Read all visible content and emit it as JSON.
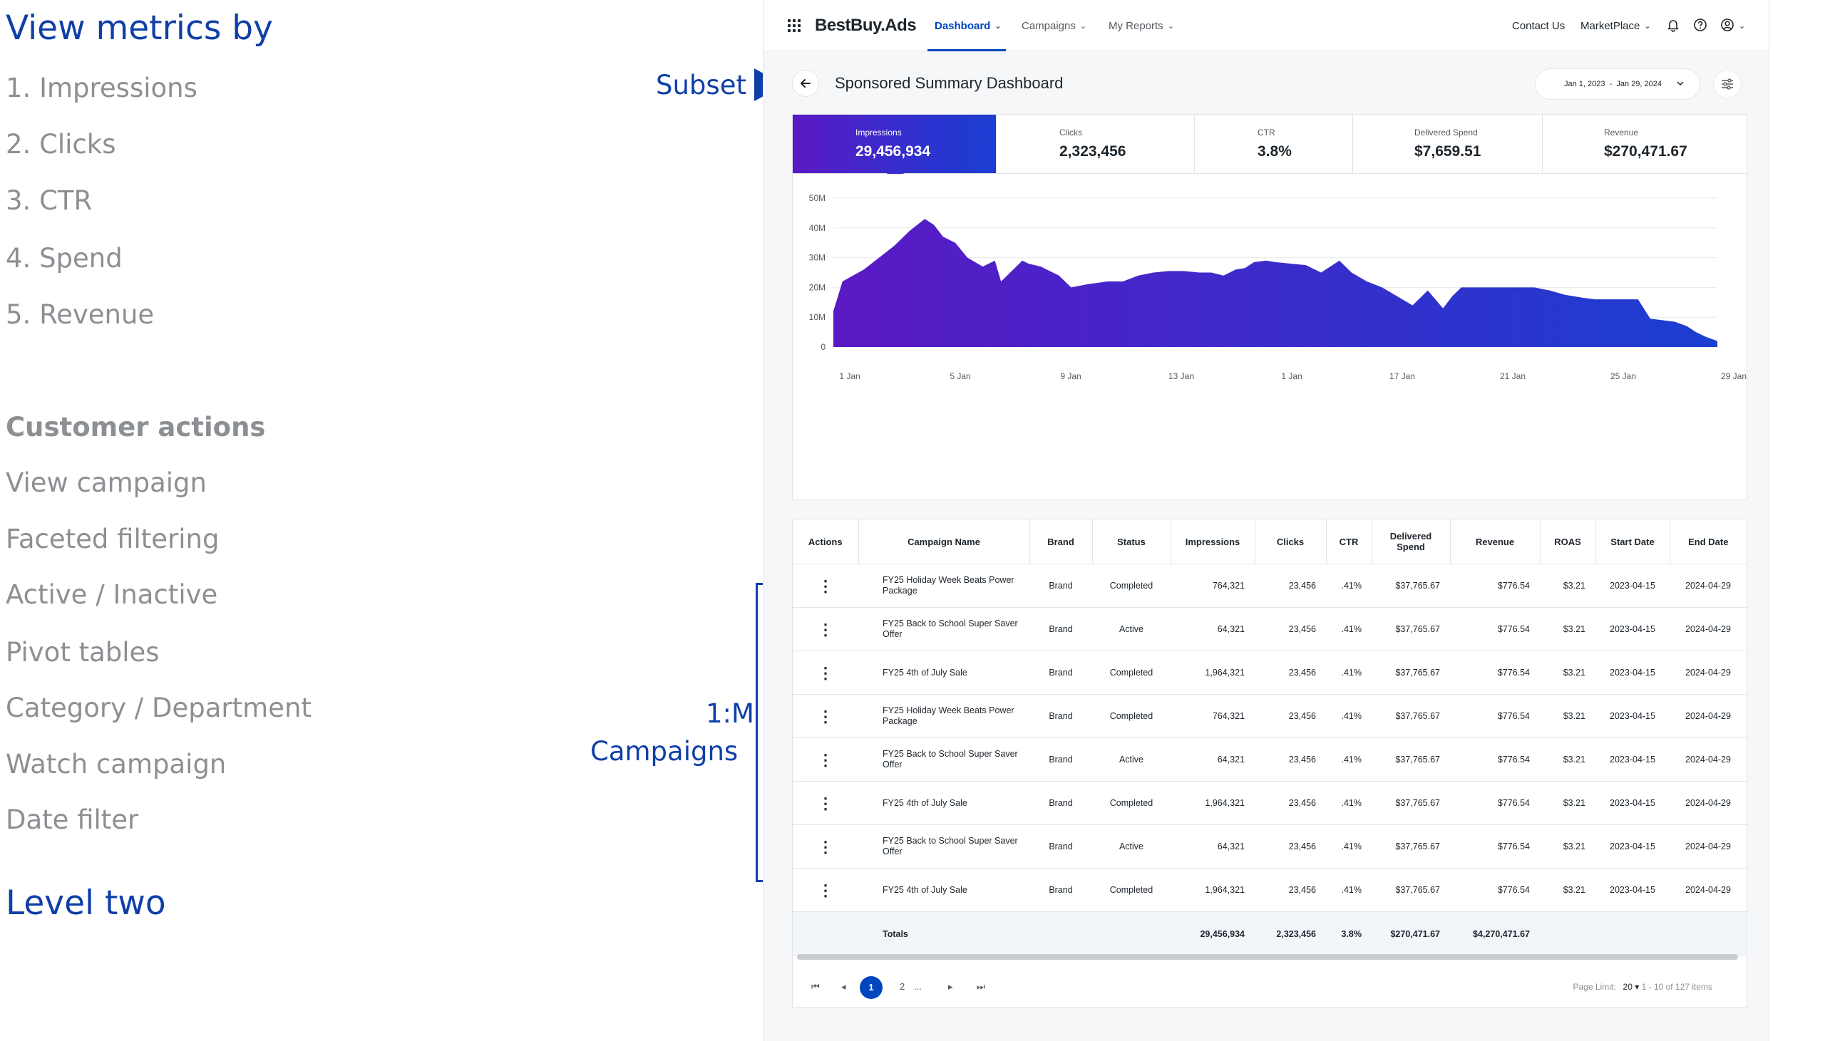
{
  "notes": {
    "view_heading": "View metrics by",
    "metrics_list": [
      "1. Impressions",
      "2. Clicks",
      "3. CTR",
      "4. Spend",
      "5. Revenue"
    ],
    "actions_heading": "Customer actions",
    "actions_list": [
      "View campaign",
      "Faceted filtering",
      "Active / Inactive",
      "Pivot tables",
      "Category / Department",
      "Watch campaign",
      "Date filter"
    ],
    "level": "Level two",
    "subset_label": "Subset",
    "one_to_many": "1:M",
    "campaigns_label": "Campaigns",
    "accent_color": "#0f3fa8"
  },
  "topbar": {
    "brand": "BestBuy.Ads",
    "nav": [
      "Dashboard",
      "Campaigns",
      "My Reports"
    ],
    "contact": "Contact Us",
    "marketplace": "MarketPlace",
    "icons": [
      "apps-grid-icon",
      "bell-icon",
      "help-icon",
      "account-icon"
    ]
  },
  "page": {
    "title": "Sponsored Summary Dashboard",
    "date_range": "Jan 1, 2023  -  Jan 29, 2024"
  },
  "metrics": [
    {
      "label": "Impressions",
      "value": "29,456,934"
    },
    {
      "label": "Clicks",
      "value": "2,323,456"
    },
    {
      "label": "CTR",
      "value": "3.8%"
    },
    {
      "label": "Delivered Spend",
      "value": "$7,659.51"
    },
    {
      "label": "Revenue",
      "value": "$270,471.67"
    }
  ],
  "chart_data": {
    "type": "area",
    "title": "",
    "xlabel": "",
    "ylabel": "",
    "ylim": [
      0,
      50
    ],
    "y_unit": "M",
    "yticks": [
      "0",
      "10M",
      "20M",
      "30M",
      "40M",
      "50M"
    ],
    "xticks": [
      "1 Jan",
      "5 Jan",
      "9 Jan",
      "13 Jan",
      "1 Jan",
      "17 Jan",
      "21 Jan",
      "25 Jan",
      "29 Jan"
    ],
    "x": [
      0,
      0.3,
      1,
      1.5,
      2,
      2.5,
      3,
      3.3,
      3.6,
      4,
      4.4,
      4.9,
      5.3,
      5.5,
      5.8,
      6,
      6.2,
      6.4,
      6.8,
      7.4,
      7.8,
      8.3,
      9,
      9.5,
      10,
      10.5,
      11,
      11.5,
      12,
      12.4,
      12.8,
      13.2,
      13.5,
      13.8,
      14.2,
      14.5,
      15,
      15.5,
      16,
      16.3,
      16.6,
      17,
      17.5,
      18,
      19,
      19.5,
      20,
      20.3,
      20.6,
      20.9,
      21.2,
      21.5,
      22,
      22.5,
      23,
      23.5,
      24,
      24.6,
      25,
      25.5,
      26,
      26.4,
      26.8,
      27.2,
      27.6,
      28,
      28.3,
      28.6,
      29
    ],
    "values": [
      12,
      22,
      26,
      30,
      34,
      39,
      43,
      41,
      37,
      35,
      30,
      27,
      29,
      22,
      25,
      27,
      29,
      28,
      27,
      24,
      20,
      21,
      22,
      22,
      24,
      25,
      25.5,
      25.5,
      25,
      25,
      24,
      26,
      26.5,
      28.5,
      29,
      28.5,
      28,
      27.5,
      25,
      27,
      29,
      25,
      22,
      20,
      14,
      19,
      13,
      17,
      20,
      20,
      20,
      20,
      20,
      20,
      20,
      19,
      17.5,
      16.5,
      16,
      16,
      16,
      16,
      9.5,
      9,
      8.5,
      7,
      5,
      3.5,
      2
    ],
    "gradient": [
      "#5b19c4",
      "#1b3ed1"
    ]
  },
  "table": {
    "headers": [
      "Actions",
      "Campaign Name",
      "Brand",
      "Status",
      "Impressions",
      "Clicks",
      "CTR",
      "Delivered Spend",
      "Revenue",
      "ROAS",
      "Start Date",
      "End Date"
    ],
    "rows": [
      [
        "⋮",
        "FY25 Holiday Week Beats Power Package",
        "Brand",
        "Completed",
        "764,321",
        "23,456",
        ".41%",
        "$37,765.67",
        "$776.54",
        "$3.21",
        "2023-04-15",
        "2024-04-29"
      ],
      [
        "⋮",
        "FY25 Back to School Super Saver Offer",
        "Brand",
        "Active",
        "64,321",
        "23,456",
        ".41%",
        "$37,765.67",
        "$776.54",
        "$3.21",
        "2023-04-15",
        "2024-04-29"
      ],
      [
        "⋮",
        "FY25 4th of July Sale",
        "Brand",
        "Completed",
        "1,964,321",
        "23,456",
        ".41%",
        "$37,765.67",
        "$776.54",
        "$3.21",
        "2023-04-15",
        "2024-04-29"
      ],
      [
        "⋮",
        "FY25 Holiday Week Beats Power Package",
        "Brand",
        "Completed",
        "764,321",
        "23,456",
        ".41%",
        "$37,765.67",
        "$776.54",
        "$3.21",
        "2023-04-15",
        "2024-04-29"
      ],
      [
        "⋮",
        "FY25 Back to School Super Saver Offer",
        "Brand",
        "Active",
        "64,321",
        "23,456",
        ".41%",
        "$37,765.67",
        "$776.54",
        "$3.21",
        "2023-04-15",
        "2024-04-29"
      ],
      [
        "⋮",
        "FY25 4th of July Sale",
        "Brand",
        "Completed",
        "1,964,321",
        "23,456",
        ".41%",
        "$37,765.67",
        "$776.54",
        "$3.21",
        "2023-04-15",
        "2024-04-29"
      ],
      [
        "⋮",
        "FY25 Back to School Super Saver Offer",
        "Brand",
        "Active",
        "64,321",
        "23,456",
        ".41%",
        "$37,765.67",
        "$776.54",
        "$3.21",
        "2023-04-15",
        "2024-04-29"
      ],
      [
        "⋮",
        "FY25 4th of July Sale",
        "Brand",
        "Completed",
        "1,964,321",
        "23,456",
        ".41%",
        "$37,765.67",
        "$776.54",
        "$3.21",
        "2023-04-15",
        "2024-04-29"
      ]
    ],
    "totals": {
      "label": "Totals",
      "impressions": "29,456,934",
      "clicks": "2,323,456",
      "ctr": "3.8%",
      "spend": "$270,471.67",
      "revenue": "$4,270,471.67"
    }
  },
  "pagination": {
    "first": "⏮",
    "prev": "◂",
    "current": "1",
    "next_page": "2",
    "ellipsis": "...",
    "next": "▸",
    "last": "⏭",
    "limit_label": "Page Limit:",
    "limit_value": "20 ▾",
    "range": "1 - 10 of 127 items"
  }
}
